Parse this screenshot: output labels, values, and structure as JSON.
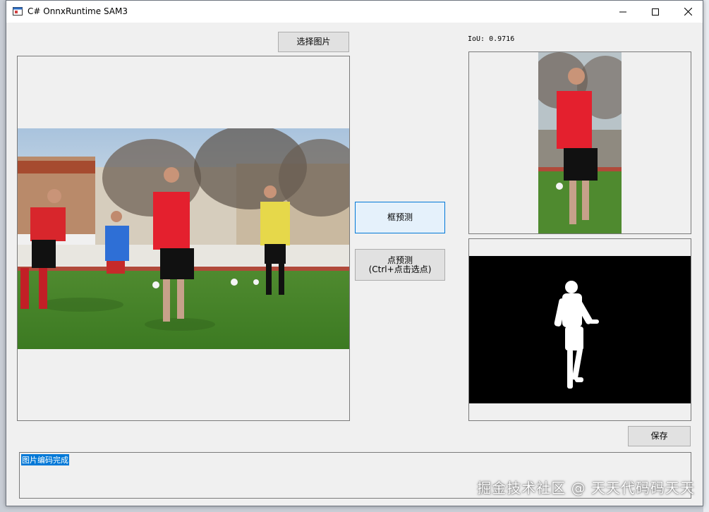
{
  "window": {
    "title": "C# OnnxRuntime SAM3"
  },
  "buttons": {
    "select_image": "选择图片",
    "box_predict": "框预测",
    "point_predict_line1": "点预测",
    "point_predict_line2": "(Ctrl+点击选点)",
    "save": "保存"
  },
  "result": {
    "iou": "IoU: 0.9716"
  },
  "log": {
    "lines": [
      "图片编码完成"
    ]
  },
  "watermark": "掘金技术社区 @ 天天代码码天天",
  "icons": {
    "app": "app-window-icon",
    "minimize": "minimize-icon",
    "maximize": "maximize-icon",
    "close": "close-icon"
  },
  "colors": {
    "focus_border": "#0078d7",
    "selection": "#0078d7",
    "mask_bg": "#000000",
    "mask_fg": "#ffffff"
  }
}
